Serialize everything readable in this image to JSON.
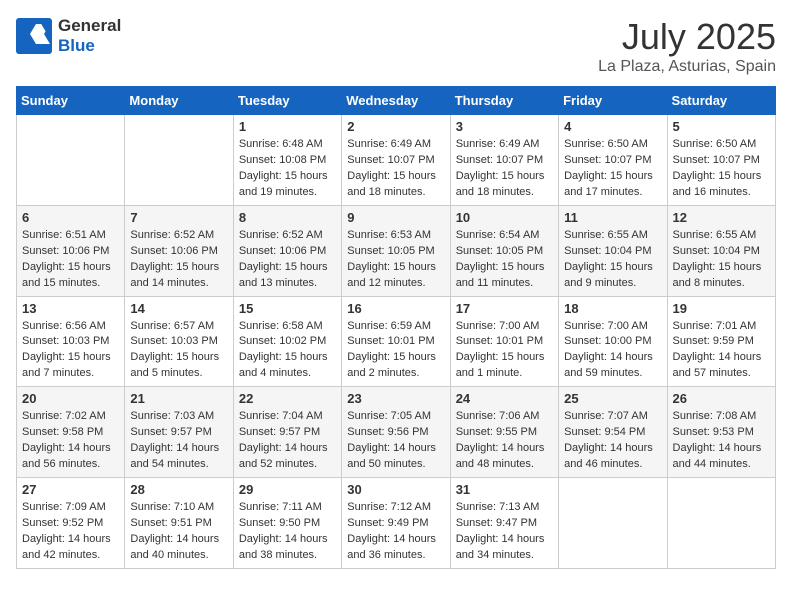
{
  "header": {
    "logo_general": "General",
    "logo_blue": "Blue",
    "title": "July 2025",
    "location": "La Plaza, Asturias, Spain"
  },
  "days_of_week": [
    "Sunday",
    "Monday",
    "Tuesday",
    "Wednesday",
    "Thursday",
    "Friday",
    "Saturday"
  ],
  "weeks": [
    [
      {
        "num": "",
        "sunrise": "",
        "sunset": "",
        "daylight": ""
      },
      {
        "num": "",
        "sunrise": "",
        "sunset": "",
        "daylight": ""
      },
      {
        "num": "1",
        "sunrise": "Sunrise: 6:48 AM",
        "sunset": "Sunset: 10:08 PM",
        "daylight": "Daylight: 15 hours and 19 minutes."
      },
      {
        "num": "2",
        "sunrise": "Sunrise: 6:49 AM",
        "sunset": "Sunset: 10:07 PM",
        "daylight": "Daylight: 15 hours and 18 minutes."
      },
      {
        "num": "3",
        "sunrise": "Sunrise: 6:49 AM",
        "sunset": "Sunset: 10:07 PM",
        "daylight": "Daylight: 15 hours and 18 minutes."
      },
      {
        "num": "4",
        "sunrise": "Sunrise: 6:50 AM",
        "sunset": "Sunset: 10:07 PM",
        "daylight": "Daylight: 15 hours and 17 minutes."
      },
      {
        "num": "5",
        "sunrise": "Sunrise: 6:50 AM",
        "sunset": "Sunset: 10:07 PM",
        "daylight": "Daylight: 15 hours and 16 minutes."
      }
    ],
    [
      {
        "num": "6",
        "sunrise": "Sunrise: 6:51 AM",
        "sunset": "Sunset: 10:06 PM",
        "daylight": "Daylight: 15 hours and 15 minutes."
      },
      {
        "num": "7",
        "sunrise": "Sunrise: 6:52 AM",
        "sunset": "Sunset: 10:06 PM",
        "daylight": "Daylight: 15 hours and 14 minutes."
      },
      {
        "num": "8",
        "sunrise": "Sunrise: 6:52 AM",
        "sunset": "Sunset: 10:06 PM",
        "daylight": "Daylight: 15 hours and 13 minutes."
      },
      {
        "num": "9",
        "sunrise": "Sunrise: 6:53 AM",
        "sunset": "Sunset: 10:05 PM",
        "daylight": "Daylight: 15 hours and 12 minutes."
      },
      {
        "num": "10",
        "sunrise": "Sunrise: 6:54 AM",
        "sunset": "Sunset: 10:05 PM",
        "daylight": "Daylight: 15 hours and 11 minutes."
      },
      {
        "num": "11",
        "sunrise": "Sunrise: 6:55 AM",
        "sunset": "Sunset: 10:04 PM",
        "daylight": "Daylight: 15 hours and 9 minutes."
      },
      {
        "num": "12",
        "sunrise": "Sunrise: 6:55 AM",
        "sunset": "Sunset: 10:04 PM",
        "daylight": "Daylight: 15 hours and 8 minutes."
      }
    ],
    [
      {
        "num": "13",
        "sunrise": "Sunrise: 6:56 AM",
        "sunset": "Sunset: 10:03 PM",
        "daylight": "Daylight: 15 hours and 7 minutes."
      },
      {
        "num": "14",
        "sunrise": "Sunrise: 6:57 AM",
        "sunset": "Sunset: 10:03 PM",
        "daylight": "Daylight: 15 hours and 5 minutes."
      },
      {
        "num": "15",
        "sunrise": "Sunrise: 6:58 AM",
        "sunset": "Sunset: 10:02 PM",
        "daylight": "Daylight: 15 hours and 4 minutes."
      },
      {
        "num": "16",
        "sunrise": "Sunrise: 6:59 AM",
        "sunset": "Sunset: 10:01 PM",
        "daylight": "Daylight: 15 hours and 2 minutes."
      },
      {
        "num": "17",
        "sunrise": "Sunrise: 7:00 AM",
        "sunset": "Sunset: 10:01 PM",
        "daylight": "Daylight: 15 hours and 1 minute."
      },
      {
        "num": "18",
        "sunrise": "Sunrise: 7:00 AM",
        "sunset": "Sunset: 10:00 PM",
        "daylight": "Daylight: 14 hours and 59 minutes."
      },
      {
        "num": "19",
        "sunrise": "Sunrise: 7:01 AM",
        "sunset": "Sunset: 9:59 PM",
        "daylight": "Daylight: 14 hours and 57 minutes."
      }
    ],
    [
      {
        "num": "20",
        "sunrise": "Sunrise: 7:02 AM",
        "sunset": "Sunset: 9:58 PM",
        "daylight": "Daylight: 14 hours and 56 minutes."
      },
      {
        "num": "21",
        "sunrise": "Sunrise: 7:03 AM",
        "sunset": "Sunset: 9:57 PM",
        "daylight": "Daylight: 14 hours and 54 minutes."
      },
      {
        "num": "22",
        "sunrise": "Sunrise: 7:04 AM",
        "sunset": "Sunset: 9:57 PM",
        "daylight": "Daylight: 14 hours and 52 minutes."
      },
      {
        "num": "23",
        "sunrise": "Sunrise: 7:05 AM",
        "sunset": "Sunset: 9:56 PM",
        "daylight": "Daylight: 14 hours and 50 minutes."
      },
      {
        "num": "24",
        "sunrise": "Sunrise: 7:06 AM",
        "sunset": "Sunset: 9:55 PM",
        "daylight": "Daylight: 14 hours and 48 minutes."
      },
      {
        "num": "25",
        "sunrise": "Sunrise: 7:07 AM",
        "sunset": "Sunset: 9:54 PM",
        "daylight": "Daylight: 14 hours and 46 minutes."
      },
      {
        "num": "26",
        "sunrise": "Sunrise: 7:08 AM",
        "sunset": "Sunset: 9:53 PM",
        "daylight": "Daylight: 14 hours and 44 minutes."
      }
    ],
    [
      {
        "num": "27",
        "sunrise": "Sunrise: 7:09 AM",
        "sunset": "Sunset: 9:52 PM",
        "daylight": "Daylight: 14 hours and 42 minutes."
      },
      {
        "num": "28",
        "sunrise": "Sunrise: 7:10 AM",
        "sunset": "Sunset: 9:51 PM",
        "daylight": "Daylight: 14 hours and 40 minutes."
      },
      {
        "num": "29",
        "sunrise": "Sunrise: 7:11 AM",
        "sunset": "Sunset: 9:50 PM",
        "daylight": "Daylight: 14 hours and 38 minutes."
      },
      {
        "num": "30",
        "sunrise": "Sunrise: 7:12 AM",
        "sunset": "Sunset: 9:49 PM",
        "daylight": "Daylight: 14 hours and 36 minutes."
      },
      {
        "num": "31",
        "sunrise": "Sunrise: 7:13 AM",
        "sunset": "Sunset: 9:47 PM",
        "daylight": "Daylight: 14 hours and 34 minutes."
      },
      {
        "num": "",
        "sunrise": "",
        "sunset": "",
        "daylight": ""
      },
      {
        "num": "",
        "sunrise": "",
        "sunset": "",
        "daylight": ""
      }
    ]
  ]
}
